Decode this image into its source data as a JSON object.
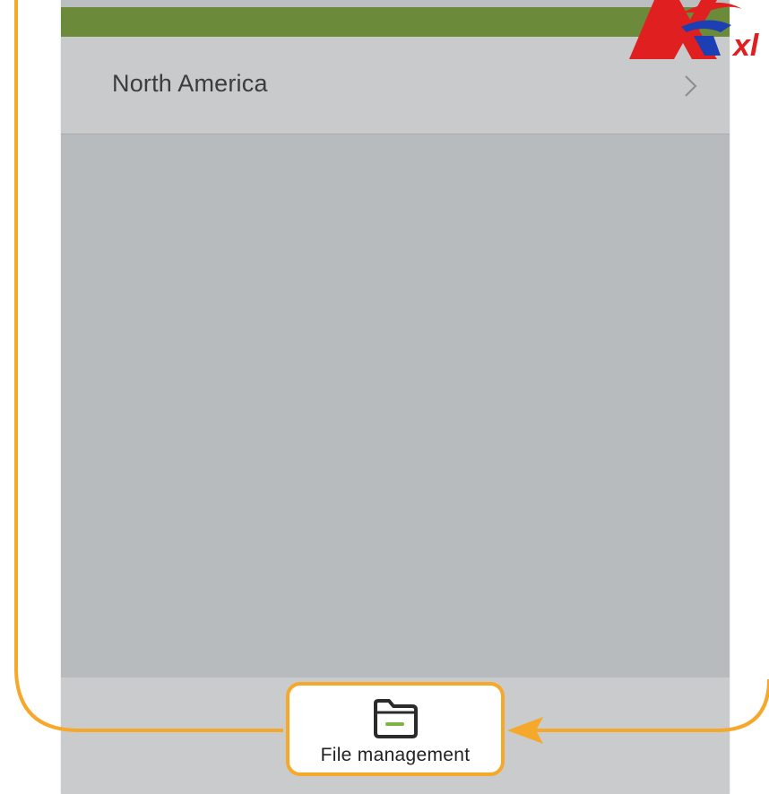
{
  "region_list": {
    "item_label": "North America"
  },
  "bottom_nav": {
    "file_management_label": "File management"
  },
  "watermark": {
    "text": "xl"
  },
  "colors": {
    "top_bar": "#6b8b3a",
    "callout": "#f5a829",
    "screen_bg": "#b8bbbe",
    "row_bg": "#c8cacb"
  },
  "icons": {
    "row_arrow": "chevron-right-icon",
    "file_management": "folder-icon"
  }
}
